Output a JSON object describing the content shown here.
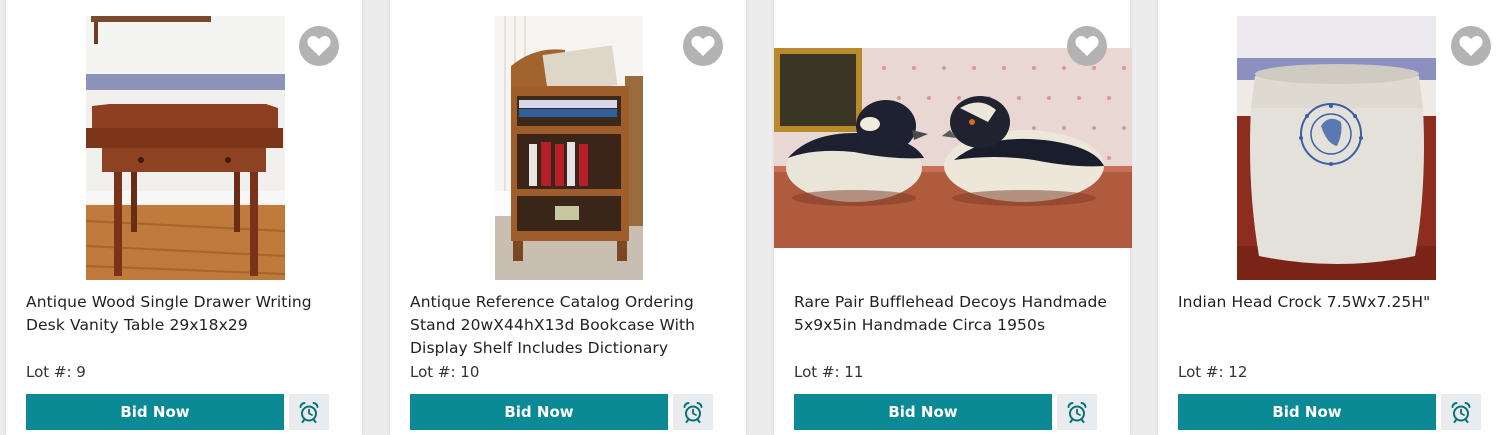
{
  "lots": [
    {
      "title": "Antique Wood Single Drawer Writing Desk Vanity Table 29x18x29",
      "lot_label": "Lot #: 9",
      "bid_label": "Bid Now",
      "image_icon": "writing-desk-photo"
    },
    {
      "title": "Antique Reference Catalog Ordering Stand 20wX44hX13d Bookcase With Display Shelf Includes Dictionary",
      "lot_label": "Lot #: 10",
      "bid_label": "Bid Now",
      "image_icon": "bookcase-stand-photo"
    },
    {
      "title": "Rare Pair Bufflehead Decoys Handmade 5x9x5in Handmade Circa 1950s",
      "lot_label": "Lot #: 11",
      "bid_label": "Bid Now",
      "image_icon": "duck-decoys-photo"
    },
    {
      "title": "Indian Head Crock 7.5Wx7.25H\"",
      "lot_label": "Lot #: 12",
      "bid_label": "Bid Now",
      "image_icon": "stoneware-crock-photo"
    }
  ],
  "colors": {
    "bid_button": "#0b8a96",
    "favorite_circle": "#b3b3b3",
    "alarm_bg": "#e9ecef",
    "alarm_icon": "#0b6f7a"
  },
  "icons": {
    "favorite": "heart-icon",
    "reminder": "alarm-clock-icon"
  }
}
